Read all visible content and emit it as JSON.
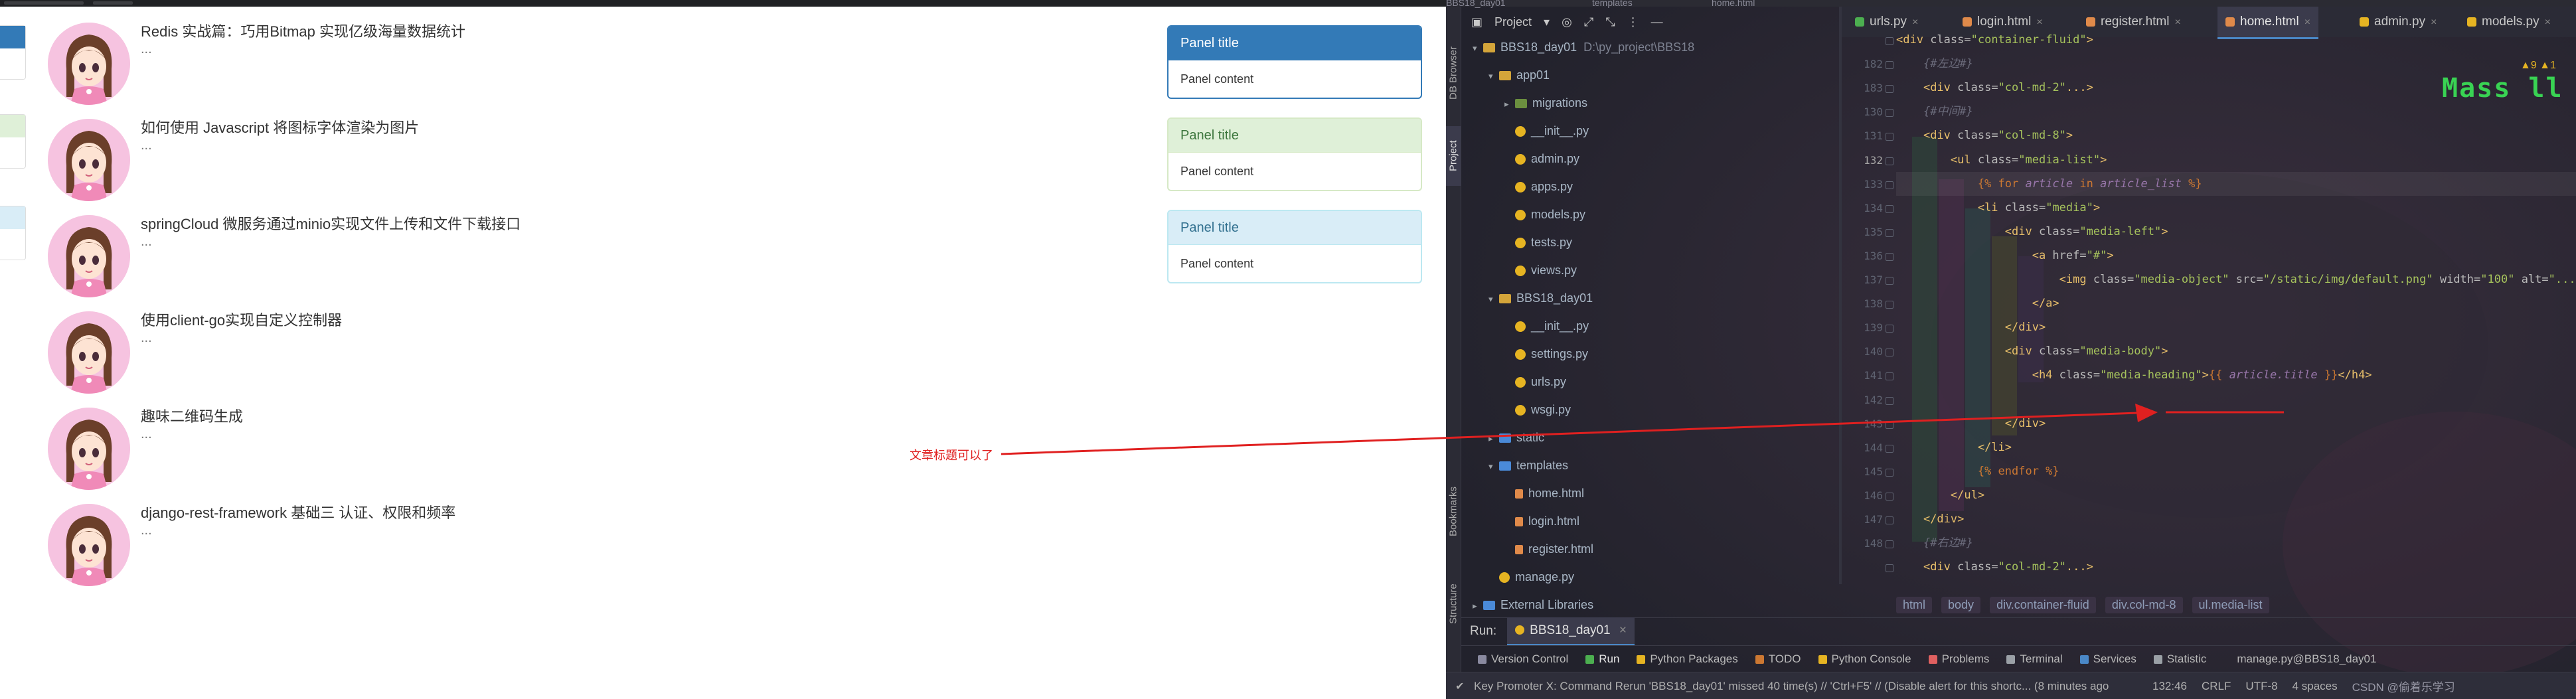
{
  "articles": [
    {
      "title": "Redis 实战篇：巧用Bitmap 实现亿级海量数据统计",
      "summary": "..."
    },
    {
      "title": "如何使用 Javascript 将图标字体渲染为图片",
      "summary": "..."
    },
    {
      "title": "springCloud 微服务通过minio实现文件上传和文件下载接口",
      "summary": "..."
    },
    {
      "title": "使用client-go实现自定义控制器",
      "summary": "..."
    },
    {
      "title": "趣味二维码生成",
      "summary": "..."
    },
    {
      "title": "django-rest-framework 基础三 认证、权限和频率",
      "summary": "..."
    }
  ],
  "panels": [
    {
      "title": "Panel title",
      "body": "Panel content",
      "style": "primary",
      "heading_bg": "#337ab7",
      "heading_fg": "#ffffff",
      "border": "#337ab7"
    },
    {
      "title": "Panel title",
      "body": "Panel content",
      "style": "success",
      "heading_bg": "#dff0d8",
      "heading_fg": "#3c763d",
      "border": "#d6e9c6"
    },
    {
      "title": "Panel title",
      "body": "Panel content",
      "style": "info",
      "heading_bg": "#d9edf7",
      "heading_fg": "#31708f",
      "border": "#bce8f1"
    }
  ],
  "annotation": {
    "text": "文章标题可以了",
    "color": "#e02020"
  },
  "ide": {
    "top_strip": [
      "BBS18_day01",
      "templates",
      "home.html"
    ],
    "vertical_tabs": {
      "db_browser": "DB Browser",
      "project": "Project",
      "bookmarks": "Bookmarks",
      "structure": "Structure"
    },
    "project_toolbar": {
      "label": "Project",
      "dropdown": "▾",
      "target_icon": "◎",
      "expand_icon": "⤢",
      "collapse_icon": "⤡",
      "menu_icon": "⋮",
      "hide_icon": "—"
    },
    "tree": [
      {
        "label": "BBS18_day01",
        "path": "D:\\py_project\\BBS18",
        "kind": "folder",
        "arrow": "▾"
      },
      {
        "label": "app01",
        "kind": "folder",
        "arrow": "▾"
      },
      {
        "label": "migrations",
        "kind": "pkg",
        "arrow": "▸"
      },
      {
        "label": "__init__.py",
        "kind": "py",
        "arrow": ""
      },
      {
        "label": "admin.py",
        "kind": "py",
        "arrow": ""
      },
      {
        "label": "apps.py",
        "kind": "py",
        "arrow": ""
      },
      {
        "label": "models.py",
        "kind": "py",
        "arrow": ""
      },
      {
        "label": "tests.py",
        "kind": "py",
        "arrow": ""
      },
      {
        "label": "views.py",
        "kind": "py",
        "arrow": ""
      },
      {
        "label": "BBS18_day01",
        "kind": "folder",
        "arrow": "▾"
      },
      {
        "label": "__init__.py",
        "kind": "py",
        "arrow": ""
      },
      {
        "label": "settings.py",
        "kind": "py",
        "arrow": ""
      },
      {
        "label": "urls.py",
        "kind": "py",
        "arrow": ""
      },
      {
        "label": "wsgi.py",
        "kind": "py",
        "arrow": ""
      },
      {
        "label": "static",
        "kind": "blue",
        "arrow": "▸"
      },
      {
        "label": "templates",
        "kind": "blue",
        "arrow": "▾"
      },
      {
        "label": "home.html",
        "kind": "html",
        "arrow": ""
      },
      {
        "label": "login.html",
        "kind": "html",
        "arrow": ""
      },
      {
        "label": "register.html",
        "kind": "html",
        "arrow": ""
      },
      {
        "label": "manage.py",
        "kind": "py",
        "arrow": ""
      },
      {
        "label": "External Libraries",
        "kind": "blue",
        "arrow": "▸"
      }
    ],
    "tabs": [
      {
        "label": "urls.py",
        "icon_color": "#4caf50",
        "active": false
      },
      {
        "label": "login.html",
        "icon_color": "#e08a4a",
        "active": false
      },
      {
        "label": "register.html",
        "icon_color": "#e08a4a",
        "active": false
      },
      {
        "label": "home.html",
        "icon_color": "#e08a4a",
        "active": true
      },
      {
        "label": "admin.py",
        "icon_color": "#e6b422",
        "active": false
      },
      {
        "label": "models.py",
        "icon_color": "#e6b422",
        "active": false
      }
    ],
    "tab_close": "×",
    "line_numbers": [
      "182",
      "183",
      "130",
      "131",
      "132",
      "133",
      "134",
      "135",
      "136",
      "137",
      "138",
      "139",
      "140",
      "141",
      "142",
      "143",
      "144",
      "145",
      "146",
      "147",
      "148"
    ],
    "current_line": "132",
    "code_lines": [
      [
        {
          "t": "<div ",
          "c": "tag"
        },
        {
          "t": "class=",
          "c": "attr"
        },
        {
          "t": "\"container-fluid\"",
          "c": "str"
        },
        {
          "t": ">",
          "c": "tag"
        }
      ],
      [
        {
          "t": "    "
        },
        {
          "t": "{#左边#}",
          "c": "cmt"
        }
      ],
      [
        {
          "t": "    "
        },
        {
          "t": "<div ",
          "c": "tag"
        },
        {
          "t": "class=",
          "c": "attr"
        },
        {
          "t": "\"col-md-2\"",
          "c": "str"
        },
        {
          "t": "...>",
          "c": "tag"
        }
      ],
      [
        {
          "t": "    "
        },
        {
          "t": "{#中间#}",
          "c": "cmt"
        }
      ],
      [
        {
          "t": "    "
        },
        {
          "t": "<div ",
          "c": "tag"
        },
        {
          "t": "class=",
          "c": "attr"
        },
        {
          "t": "\"col-md-8\"",
          "c": "str"
        },
        {
          "t": ">",
          "c": "tag"
        }
      ],
      [
        {
          "t": "        "
        },
        {
          "t": "<ul ",
          "c": "tag"
        },
        {
          "t": "class=",
          "c": "attr"
        },
        {
          "t": "\"media-list\"",
          "c": "str"
        },
        {
          "t": ">",
          "c": "tag"
        }
      ],
      [
        {
          "t": "            "
        },
        {
          "t": "{% for ",
          "c": "tpl"
        },
        {
          "t": "article",
          "c": "var"
        },
        {
          "t": " in ",
          "c": "tpl"
        },
        {
          "t": "article_list",
          "c": "var"
        },
        {
          "t": " %}",
          "c": "tpl"
        }
      ],
      [
        {
          "t": "            "
        },
        {
          "t": "<li ",
          "c": "tag"
        },
        {
          "t": "class=",
          "c": "attr"
        },
        {
          "t": "\"media\"",
          "c": "str"
        },
        {
          "t": ">",
          "c": "tag"
        }
      ],
      [
        {
          "t": "                "
        },
        {
          "t": "<div ",
          "c": "tag"
        },
        {
          "t": "class=",
          "c": "attr"
        },
        {
          "t": "\"media-left\"",
          "c": "str"
        },
        {
          "t": ">",
          "c": "tag"
        }
      ],
      [
        {
          "t": "                    "
        },
        {
          "t": "<a ",
          "c": "tag"
        },
        {
          "t": "href=",
          "c": "attr"
        },
        {
          "t": "\"#\"",
          "c": "str"
        },
        {
          "t": ">",
          "c": "tag"
        }
      ],
      [
        {
          "t": "                        "
        },
        {
          "t": "<img ",
          "c": "tag"
        },
        {
          "t": "class=",
          "c": "attr"
        },
        {
          "t": "\"media-object\" ",
          "c": "str"
        },
        {
          "t": "src=",
          "c": "attr"
        },
        {
          "t": "\"/static/img/default.png\" ",
          "c": "str"
        },
        {
          "t": "width=",
          "c": "attr"
        },
        {
          "t": "\"100\" ",
          "c": "str"
        },
        {
          "t": "alt=",
          "c": "attr"
        },
        {
          "t": "\"...\"",
          "c": "str"
        },
        {
          "t": ">",
          "c": "tag"
        }
      ],
      [
        {
          "t": "                    "
        },
        {
          "t": "</a>",
          "c": "tag"
        }
      ],
      [
        {
          "t": "                "
        },
        {
          "t": "</div>",
          "c": "tag"
        }
      ],
      [
        {
          "t": "                "
        },
        {
          "t": "<div ",
          "c": "tag"
        },
        {
          "t": "class=",
          "c": "attr"
        },
        {
          "t": "\"media-body\"",
          "c": "str"
        },
        {
          "t": ">",
          "c": "tag"
        }
      ],
      [
        {
          "t": "                    "
        },
        {
          "t": "<h4 ",
          "c": "tag"
        },
        {
          "t": "class=",
          "c": "attr"
        },
        {
          "t": "\"media-heading\"",
          "c": "str"
        },
        {
          "t": ">",
          "c": "tag"
        },
        {
          "t": "{{ ",
          "c": "tpl"
        },
        {
          "t": "article.title",
          "c": "var"
        },
        {
          "t": " }}",
          "c": "tpl"
        },
        {
          "t": "</h4>",
          "c": "tag"
        }
      ],
      [
        {
          "t": ""
        }
      ],
      [
        {
          "t": "                "
        },
        {
          "t": "</div>",
          "c": "tag"
        }
      ],
      [
        {
          "t": "            "
        },
        {
          "t": "</li>",
          "c": "tag"
        }
      ],
      [
        {
          "t": "            "
        },
        {
          "t": "{% endfor %}",
          "c": "tpl"
        }
      ],
      [
        {
          "t": "        "
        },
        {
          "t": "</ul>",
          "c": "tag"
        }
      ],
      [
        {
          "t": "    "
        },
        {
          "t": "</div>",
          "c": "tag"
        }
      ],
      [
        {
          "t": "    "
        },
        {
          "t": "{#右边#}",
          "c": "cmt"
        }
      ],
      [
        {
          "t": "    "
        },
        {
          "t": "<div ",
          "c": "tag"
        },
        {
          "t": "class=",
          "c": "attr"
        },
        {
          "t": "\"col-md-2\"",
          "c": "str"
        },
        {
          "t": "...>",
          "c": "tag"
        }
      ]
    ],
    "gutter_numbers": [
      "",
      "182",
      "183",
      "130",
      "131",
      "132",
      "133",
      "134",
      "135",
      "136",
      "137",
      "138",
      "139",
      "140",
      "141",
      "142",
      "143",
      "144",
      "145",
      "146",
      "147",
      "148"
    ],
    "logo_text": "Mass ll",
    "warning_indicator": "▲9 ▲1",
    "breadcrumbs": [
      "html",
      "body",
      "div.container-fluid",
      "div.col-md-8",
      "ul.media-list"
    ],
    "run": {
      "label": "Run:",
      "config": "BBS18_day01",
      "close": "×"
    },
    "tool_windows": [
      {
        "label": "Version Control",
        "icon_color": "#8a8aa0",
        "active": false
      },
      {
        "label": "Run",
        "icon_color": "#4caf50",
        "active": true
      },
      {
        "label": "Python Packages",
        "icon_color": "#e6b422",
        "active": false
      },
      {
        "label": "TODO",
        "icon_color": "#cc7832",
        "active": false
      },
      {
        "label": "Python Console",
        "icon_color": "#e6b422",
        "active": false
      },
      {
        "label": "Problems",
        "icon_color": "#e06060",
        "active": false
      },
      {
        "label": "Terminal",
        "icon_color": "#9aa0a6",
        "active": false
      },
      {
        "label": "Services",
        "icon_color": "#4a88c7",
        "active": false
      },
      {
        "label": "Statistic",
        "icon_color": "#9aa0a6",
        "active": false
      },
      {
        "label": "manage.py@BBS18_day01",
        "icon_color": "",
        "active": false
      }
    ],
    "status": {
      "message": "Key Promoter X: Command Rerun 'BBS18_day01' missed 40 time(s) // 'Ctrl+F5' // (Disable alert for this shortc... (8 minutes ago",
      "position": "132:46",
      "line_sep": "CRLF",
      "encoding": "UTF-8",
      "indent": "4 spaces",
      "watermark": "CSDN @偷着乐学习"
    }
  }
}
